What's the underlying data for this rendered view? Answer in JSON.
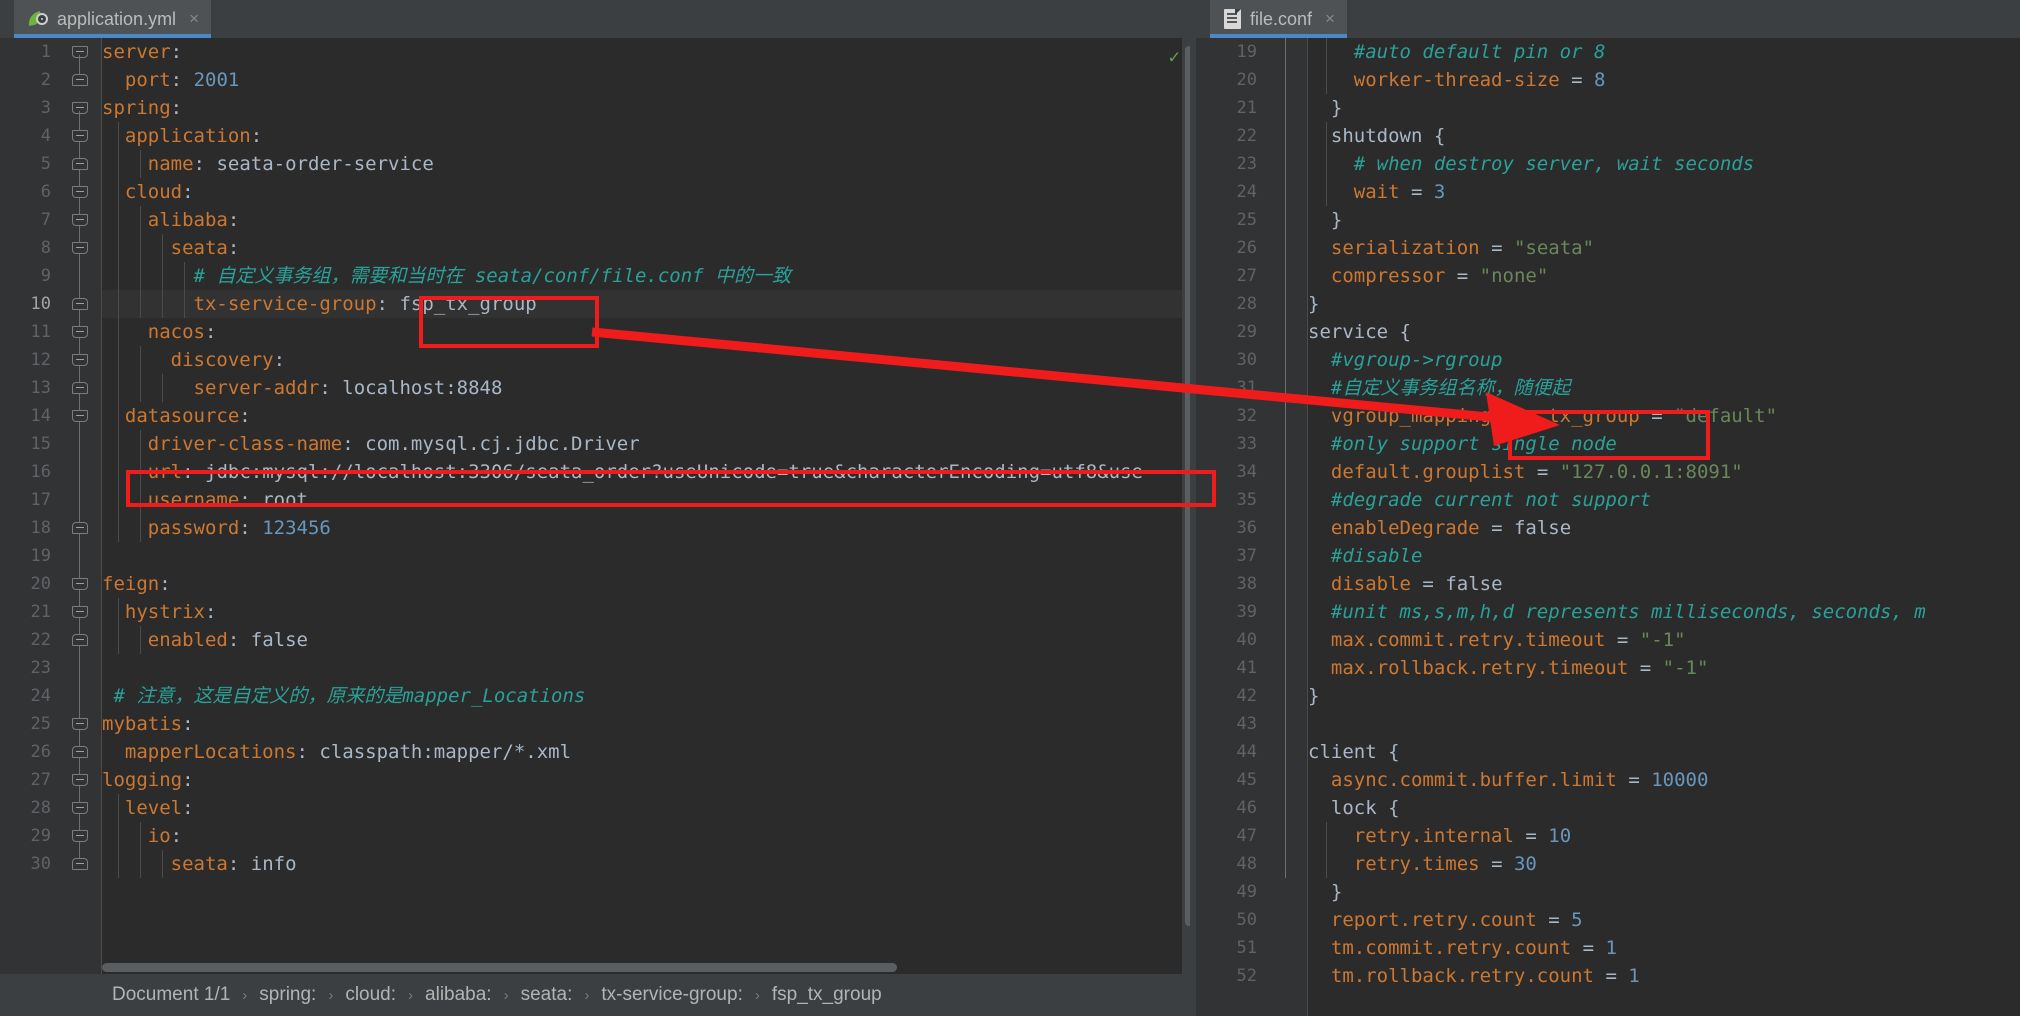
{
  "window": {
    "background": "#3c3f41",
    "editor_background": "#2b2b2b",
    "accent": "#4a88c7",
    "annotation_color": "#f01c1c"
  },
  "left_pane": {
    "tab": {
      "label": "application.yml",
      "icon": "spring-leaf-icon",
      "close": "×",
      "active": true
    },
    "first_line": 1,
    "current_line": 10,
    "lines": [
      {
        "n": 1,
        "text": "server:"
      },
      {
        "n": 2,
        "text": "  port: 2001"
      },
      {
        "n": 3,
        "text": "spring:"
      },
      {
        "n": 4,
        "text": "  application:"
      },
      {
        "n": 5,
        "text": "    name: seata-order-service"
      },
      {
        "n": 6,
        "text": "  cloud:"
      },
      {
        "n": 7,
        "text": "    alibaba:"
      },
      {
        "n": 8,
        "text": "      seata:"
      },
      {
        "n": 9,
        "text": "        # 自定义事务组，需要和当时在 seata/conf/file.conf 中的一致"
      },
      {
        "n": 10,
        "text": "        tx-service-group: fsp_tx_group"
      },
      {
        "n": 11,
        "text": "    nacos:"
      },
      {
        "n": 12,
        "text": "      discovery:"
      },
      {
        "n": 13,
        "text": "        server-addr: localhost:8848"
      },
      {
        "n": 14,
        "text": "  datasource:"
      },
      {
        "n": 15,
        "text": "    driver-class-name: com.mysql.cj.jdbc.Driver"
      },
      {
        "n": 16,
        "text": "    url: jdbc:mysql://localhost:3306/seata_order?useUnicode=true&characterEncoding=utf8&use"
      },
      {
        "n": 17,
        "text": "    username: root"
      },
      {
        "n": 18,
        "text": "    password: 123456"
      },
      {
        "n": 19,
        "text": ""
      },
      {
        "n": 20,
        "text": "feign:"
      },
      {
        "n": 21,
        "text": "  hystrix:"
      },
      {
        "n": 22,
        "text": "    enabled: false"
      },
      {
        "n": 23,
        "text": ""
      },
      {
        "n": 24,
        "text": " # 注意，这是自定义的，原来的是mapper_Locations"
      },
      {
        "n": 25,
        "text": "mybatis:"
      },
      {
        "n": 26,
        "text": "  mapperLocations: classpath:mapper/*.xml"
      },
      {
        "n": 27,
        "text": "logging:"
      },
      {
        "n": 28,
        "text": "  level:"
      },
      {
        "n": 29,
        "text": "    io:"
      },
      {
        "n": 30,
        "text": "      seata: info"
      }
    ],
    "breadcrumb": [
      "Document 1/1",
      "spring:",
      "cloud:",
      "alibaba:",
      "seata:",
      "tx-service-group:",
      "fsp_tx_group"
    ],
    "breadcrumb_separator": "›",
    "inspection_status": "✓"
  },
  "right_pane": {
    "tab": {
      "label": "file.conf",
      "icon": "conf-file-icon",
      "close": "×",
      "active": true
    },
    "first_line": 19,
    "lines": [
      {
        "n": 19,
        "text": "    #auto default pin or 8"
      },
      {
        "n": 20,
        "text": "    worker-thread-size = 8"
      },
      {
        "n": 21,
        "text": "  }"
      },
      {
        "n": 22,
        "text": "  shutdown {"
      },
      {
        "n": 23,
        "text": "    # when destroy server, wait seconds"
      },
      {
        "n": 24,
        "text": "    wait = 3"
      },
      {
        "n": 25,
        "text": "  }"
      },
      {
        "n": 26,
        "text": "  serialization = \"seata\""
      },
      {
        "n": 27,
        "text": "  compressor = \"none\""
      },
      {
        "n": 28,
        "text": "}"
      },
      {
        "n": 29,
        "text": "service {"
      },
      {
        "n": 30,
        "text": "  #vgroup->rgroup"
      },
      {
        "n": 31,
        "text": "  #自定义事务组名称，随便起"
      },
      {
        "n": 32,
        "text": "  vgroup_mapping.fsp_tx_group = \"default\""
      },
      {
        "n": 33,
        "text": "  #only support single node"
      },
      {
        "n": 34,
        "text": "  default.grouplist = \"127.0.0.1:8091\""
      },
      {
        "n": 35,
        "text": "  #degrade current not support"
      },
      {
        "n": 36,
        "text": "  enableDegrade = false"
      },
      {
        "n": 37,
        "text": "  #disable"
      },
      {
        "n": 38,
        "text": "  disable = false"
      },
      {
        "n": 39,
        "text": "  #unit ms,s,m,h,d represents milliseconds, seconds, m"
      },
      {
        "n": 40,
        "text": "  max.commit.retry.timeout = \"-1\""
      },
      {
        "n": 41,
        "text": "  max.rollback.retry.timeout = \"-1\""
      },
      {
        "n": 42,
        "text": "}"
      },
      {
        "n": 43,
        "text": ""
      },
      {
        "n": 44,
        "text": "client {"
      },
      {
        "n": 45,
        "text": "  async.commit.buffer.limit = 10000"
      },
      {
        "n": 46,
        "text": "  lock {"
      },
      {
        "n": 47,
        "text": "    retry.internal = 10"
      },
      {
        "n": 48,
        "text": "    retry.times = 30"
      },
      {
        "n": 49,
        "text": "  }"
      },
      {
        "n": 50,
        "text": "  report.retry.count = 5"
      },
      {
        "n": 51,
        "text": "  tm.commit.retry.count = 1"
      },
      {
        "n": 52,
        "text": "  tm.rollback.retry.count = 1"
      }
    ]
  },
  "annotations": {
    "box_tx_service_group_value": "fsp_tx_group",
    "box_url_line": "url: jdbc:mysql://localhost:3306/seata_order?useUnicode=true&characterEncoding=utf8&use",
    "box_vgroup_mapping_value": "fsp_tx_group",
    "arrow_label": "arrow-from-tx-service-group-to-vgroup-mapping"
  }
}
